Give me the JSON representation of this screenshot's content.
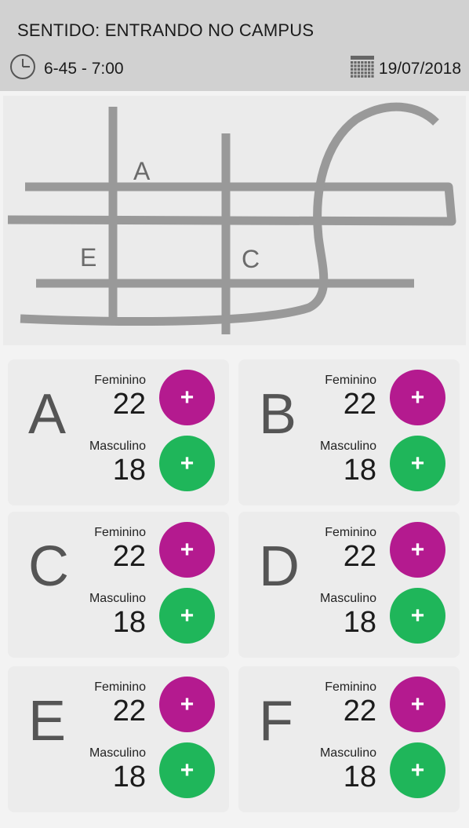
{
  "header": {
    "title": "SENTIDO: ENTRANDO NO CAMPUS",
    "time_range": "6-45 - 7:00",
    "date": "19/07/2018",
    "time_icon": "clock-icon",
    "date_icon": "calendar-icon"
  },
  "map": {
    "labels": [
      "A",
      "E",
      "C"
    ],
    "road_color": "#999999",
    "background_color": "#ebebeb"
  },
  "colors": {
    "feminino_button": "#b41a8f",
    "masculino_button": "#1fb65a"
  },
  "cards": [
    {
      "letter": "A",
      "feminino_label": "Feminino",
      "feminino_count": "22",
      "masculino_label": "Masculino",
      "masculino_count": "18",
      "button_symbol": "+"
    },
    {
      "letter": "B",
      "feminino_label": "Feminino",
      "feminino_count": "22",
      "masculino_label": "Masculino",
      "masculino_count": "18",
      "button_symbol": "+"
    },
    {
      "letter": "C",
      "feminino_label": "Feminino",
      "feminino_count": "22",
      "masculino_label": "Masculino",
      "masculino_count": "18",
      "button_symbol": "+"
    },
    {
      "letter": "D",
      "feminino_label": "Feminino",
      "feminino_count": "22",
      "masculino_label": "Masculino",
      "masculino_count": "18",
      "button_symbol": "+"
    },
    {
      "letter": "E",
      "feminino_label": "Feminino",
      "feminino_count": "22",
      "masculino_label": "Masculino",
      "masculino_count": "18",
      "button_symbol": "+"
    },
    {
      "letter": "F",
      "feminino_label": "Feminino",
      "feminino_count": "22",
      "masculino_label": "Masculino",
      "masculino_count": "18",
      "button_symbol": "+"
    }
  ]
}
